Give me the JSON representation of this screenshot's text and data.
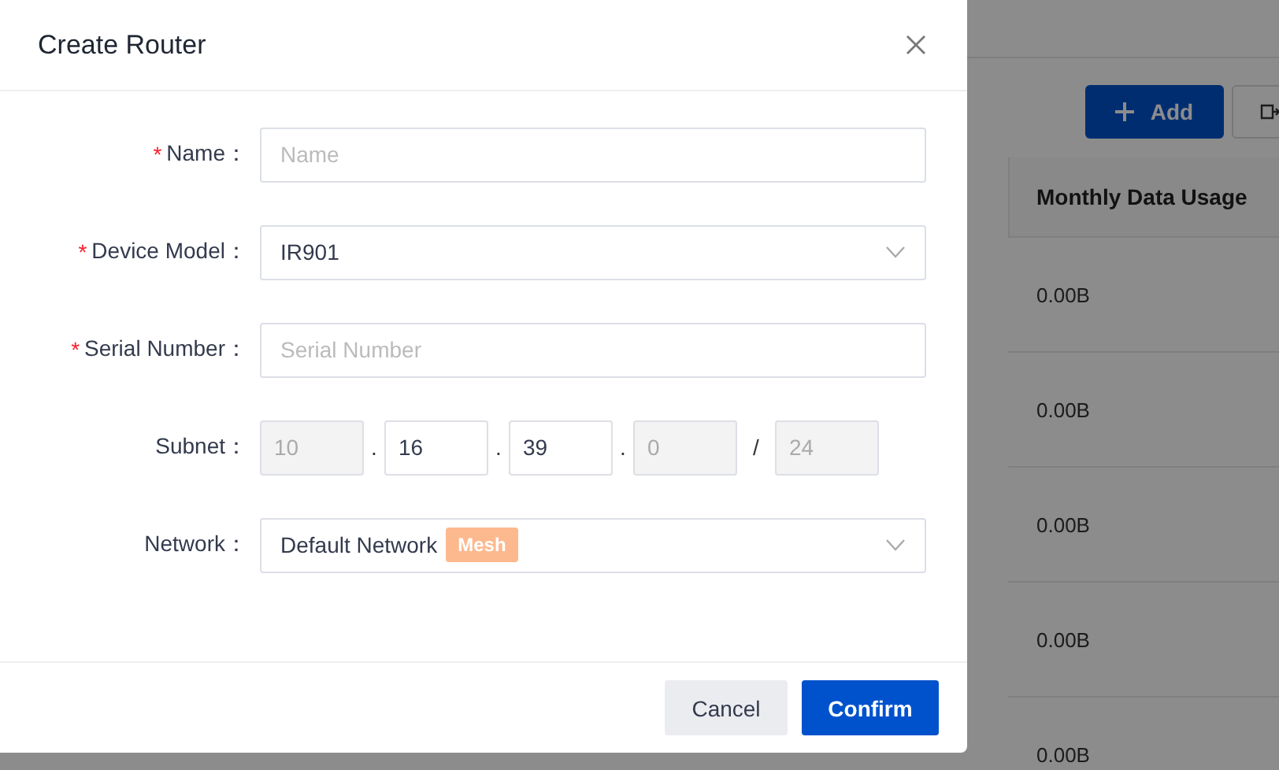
{
  "background_page": {
    "add_button": "Add",
    "table": {
      "columns": [
        "Monthly Data Usage"
      ],
      "rows": [
        [
          "0.00B"
        ],
        [
          "0.00B"
        ],
        [
          "0.00B"
        ],
        [
          "0.00B"
        ],
        [
          "0.00B"
        ]
      ]
    }
  },
  "dialog": {
    "title": "Create Router",
    "fields": [
      {
        "kind": "text",
        "required_mark": "*",
        "label": "Name：",
        "placeholder": "Name"
      },
      {
        "kind": "select",
        "required_mark": "*",
        "label": "Device Model：",
        "value": "IR901"
      },
      {
        "kind": "text",
        "required_mark": "*",
        "label": "Serial Number：",
        "placeholder": "Serial Number"
      },
      {
        "kind": "subnet",
        "label": "Subnet：",
        "parts": [
          {
            "kind": "input",
            "value": "10",
            "disabled": true
          },
          {
            "kind": "separator",
            "text": "."
          },
          {
            "kind": "input",
            "value": "16",
            "disabled": false
          },
          {
            "kind": "separator",
            "text": "."
          },
          {
            "kind": "input",
            "value": "39",
            "disabled": false
          },
          {
            "kind": "separator",
            "text": "."
          },
          {
            "kind": "input",
            "value": "0",
            "disabled": true
          },
          {
            "kind": "separator",
            "text": "/"
          },
          {
            "kind": "input",
            "value": "24",
            "disabled": true
          }
        ]
      },
      {
        "kind": "select",
        "label": "Network：",
        "value": "Default Network",
        "tag": "Mesh"
      }
    ],
    "buttons": [
      {
        "label": "Cancel",
        "kind": "secondary"
      },
      {
        "label": "Confirm",
        "kind": "primary"
      }
    ]
  }
}
